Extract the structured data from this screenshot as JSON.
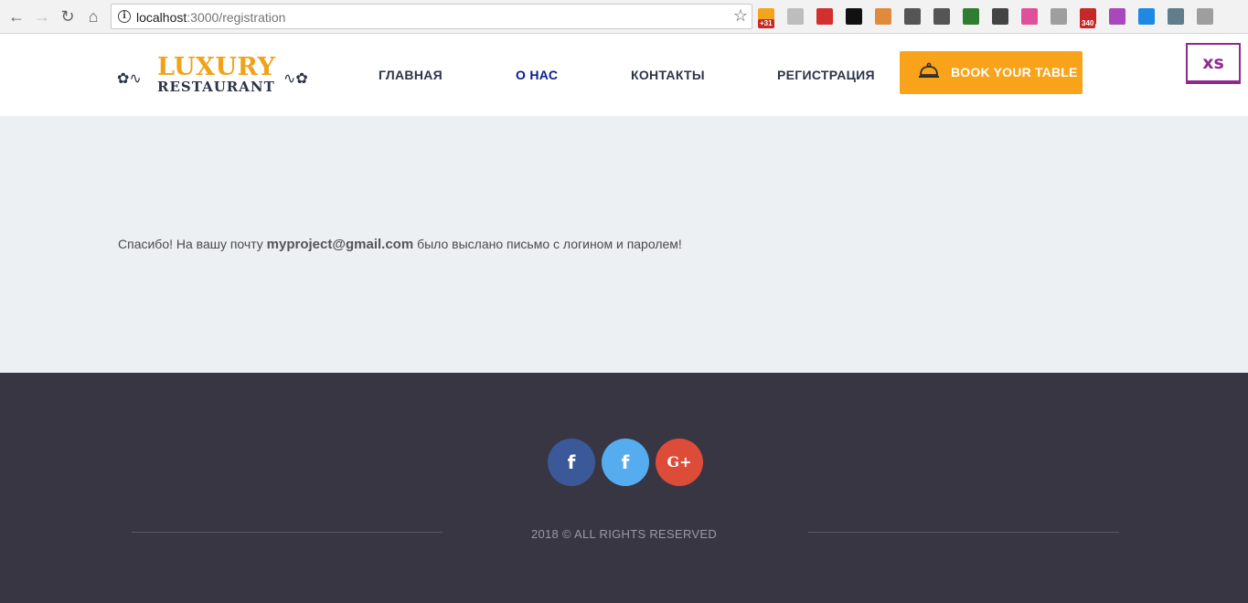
{
  "browser": {
    "url_host": "localhost",
    "url_path": ":3000/registration",
    "extensions": [
      {
        "name": "calendar-ext-icon",
        "badge": "+31",
        "color": "#f2a51c"
      },
      {
        "name": "pdf-ext-icon",
        "badge": "",
        "color": "#bdbdbd"
      },
      {
        "name": "adblock-ext-icon",
        "badge": "",
        "color": "#d32f2f"
      },
      {
        "name": "jb-ext-icon",
        "badge": "",
        "color": "#111111"
      },
      {
        "name": "ruler-ext-icon",
        "badge": "",
        "color": "#e08a3b"
      },
      {
        "name": "eyedropper-ext-icon",
        "badge": "",
        "color": "#555555"
      },
      {
        "name": "screenshot-ext-icon",
        "badge": "",
        "color": "#555555"
      },
      {
        "name": "bw-ext-icon",
        "badge": "",
        "color": "#2e7d32"
      },
      {
        "name": "sync-ext-icon",
        "badge": "",
        "color": "#444444"
      },
      {
        "name": "gradient-ext-icon",
        "badge": "",
        "color": "#e0509a"
      },
      {
        "name": "layout-ext-icon",
        "badge": "",
        "color": "#9e9e9e"
      },
      {
        "name": "gmail-ext-icon",
        "badge": "340",
        "color": "#c62828"
      },
      {
        "name": "lg-ext-icon",
        "badge": "",
        "color": "#ab47bc"
      },
      {
        "name": "upload-ext-icon",
        "badge": "",
        "color": "#1e88e5"
      },
      {
        "name": "c-ext-icon",
        "badge": "",
        "color": "#607d8b"
      },
      {
        "name": "json-ext-icon",
        "badge": "",
        "color": "#9e9e9e"
      }
    ]
  },
  "header": {
    "logo_top": "LUXURY",
    "logo_bottom": "RESTAURANT",
    "nav": [
      {
        "label": "ГЛАВНАЯ",
        "active": false
      },
      {
        "label": "О НАС",
        "active": true
      },
      {
        "label": "КОНТАКТЫ",
        "active": false
      },
      {
        "label": "РЕГИСТРАЦИЯ",
        "active": false
      }
    ],
    "book_label": "BOOK YOUR TABLE",
    "xs_label": "xs"
  },
  "content": {
    "message_before": "Спасибо! На вашу почту ",
    "email": "myproject@gmail.com",
    "message_after": " было выслано письмо с логином и паролем!"
  },
  "footer": {
    "social": [
      {
        "name": "facebook",
        "glyph": "f"
      },
      {
        "name": "facebook",
        "glyph": "f"
      },
      {
        "name": "google-plus",
        "glyph": "G+"
      }
    ],
    "copyright": "2018 © ALL RIGHTS RESERVED"
  }
}
